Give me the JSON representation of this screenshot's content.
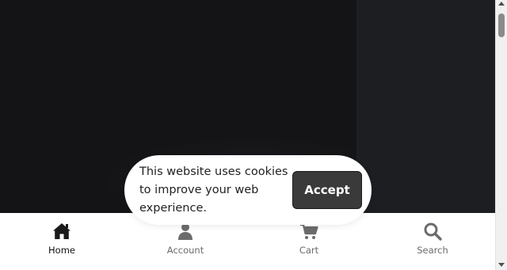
{
  "cookie_banner": {
    "message": "This website uses cookies to improve your web experience.",
    "accept_label": "Accept"
  },
  "bottom_nav": {
    "items": [
      {
        "label": "Home",
        "icon": "home-icon",
        "active": true
      },
      {
        "label": "Account",
        "icon": "user-icon",
        "active": false
      },
      {
        "label": "Cart",
        "icon": "cart-icon",
        "active": false
      },
      {
        "label": "Search",
        "icon": "search-icon",
        "active": false
      }
    ]
  },
  "colors": {
    "background_dark": "#141416",
    "panel_dark": "#1d1e21",
    "nav_background": "#ffffff",
    "accept_button": "#3a3a3a",
    "active_label": "#111111",
    "inactive_label": "#6b6b6b"
  }
}
